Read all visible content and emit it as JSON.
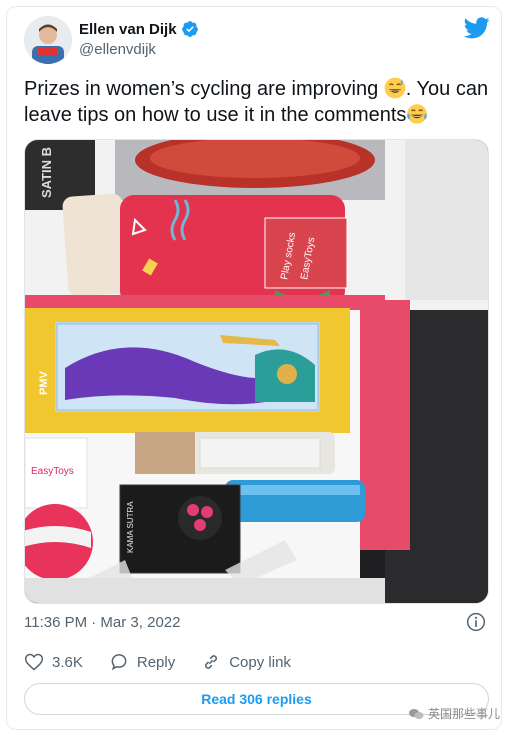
{
  "author": {
    "name": "Ellen van Dijk",
    "handle": "@ellenvdijk",
    "verified": true
  },
  "tweet": {
    "text_parts": [
      "Prizes in women’s cycling are improving ",
      ". You can leave tips on how to use it in the comments"
    ],
    "emojis": [
      "sweat-smile-emoji",
      "tears-of-joy-emoji"
    ]
  },
  "meta": {
    "timestamp": "11:36 PM · Mar 3, 2022"
  },
  "actions": {
    "likes_count": "3.6K",
    "reply_label": "Reply",
    "copy_link_label": "Copy link"
  },
  "read_replies_label": "Read 306 replies",
  "photo_text": {
    "satin": "SATIN B",
    "sock_tag": "Play socks",
    "sock_brand": "EasyToys",
    "box_brand": "PMV",
    "small_box_brand": "EasyToys",
    "card_box": "KAMA SUTRA"
  },
  "watermark": "英国那些事儿",
  "colors": {
    "brand_blue": "#1d9bf0",
    "muted": "#536471"
  }
}
